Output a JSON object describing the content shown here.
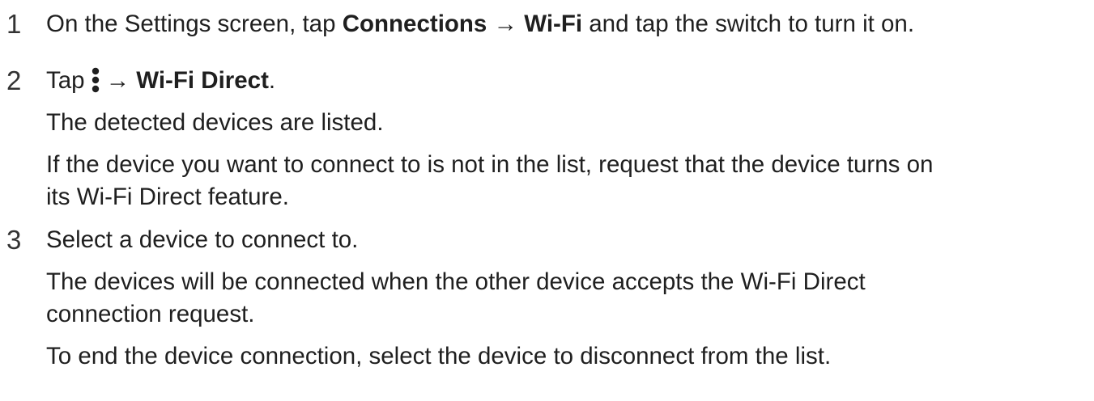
{
  "steps": [
    {
      "number": "1",
      "line1": {
        "t1": "On the Settings screen, tap ",
        "b1": "Connections",
        "arrow1": " → ",
        "b2": "Wi-Fi",
        "t2": " and tap the switch to turn it on."
      }
    },
    {
      "number": "2",
      "line1": {
        "t1": "Tap",
        "arrow1": "→ ",
        "b1": "Wi-Fi Direct",
        "t2": "."
      },
      "lines": [
        "The detected devices are listed.",
        "If the device you want to connect to is not in the list, request that the device turns on",
        "its Wi-Fi Direct feature."
      ]
    },
    {
      "number": "3",
      "lines": [
        "Select a device to connect to.",
        "The devices will be connected when the other device accepts the Wi-Fi Direct",
        "connection request.",
        "To end the device connection, select the device to disconnect from the list."
      ]
    }
  ],
  "icons": {
    "more_options": "more-options-vertical-dots-icon"
  }
}
